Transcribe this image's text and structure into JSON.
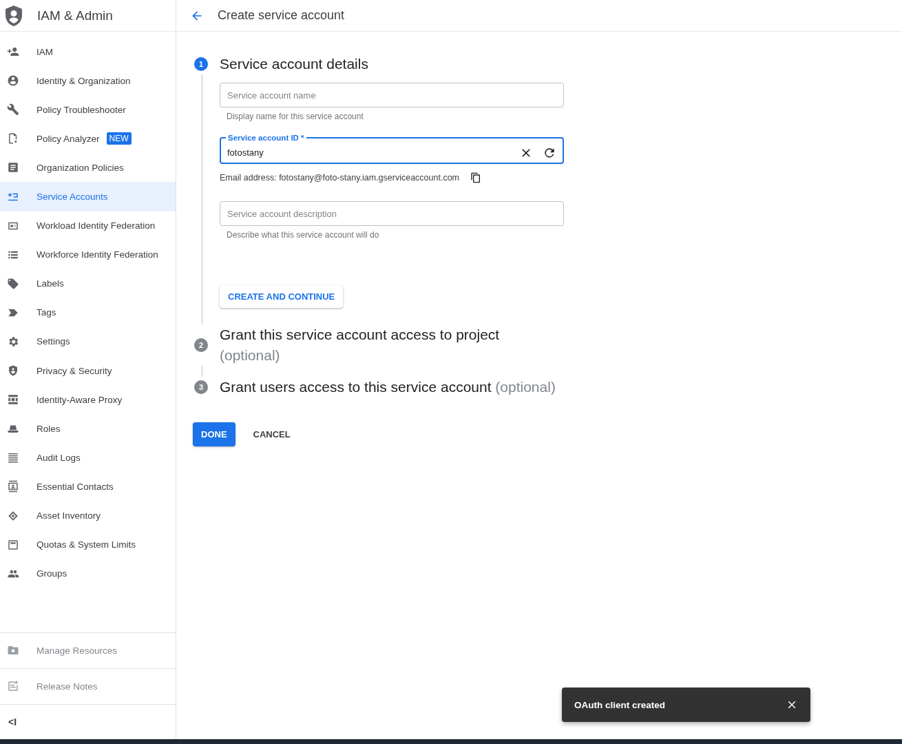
{
  "sidebar": {
    "title": "IAM & Admin",
    "items": [
      {
        "label": "IAM",
        "selected": false
      },
      {
        "label": "Identity & Organization",
        "selected": false
      },
      {
        "label": "Policy Troubleshooter",
        "selected": false
      },
      {
        "label": "Policy Analyzer",
        "selected": false,
        "badge": "NEW"
      },
      {
        "label": "Organization Policies",
        "selected": false
      },
      {
        "label": "Service Accounts",
        "selected": true
      },
      {
        "label": "Workload Identity Federation",
        "selected": false
      },
      {
        "label": "Workforce Identity Federation",
        "selected": false
      },
      {
        "label": "Labels",
        "selected": false
      },
      {
        "label": "Tags",
        "selected": false
      },
      {
        "label": "Settings",
        "selected": false
      },
      {
        "label": "Privacy & Security",
        "selected": false
      },
      {
        "label": "Identity-Aware Proxy",
        "selected": false
      },
      {
        "label": "Roles",
        "selected": false
      },
      {
        "label": "Audit Logs",
        "selected": false
      },
      {
        "label": "Essential Contacts",
        "selected": false
      },
      {
        "label": "Asset Inventory",
        "selected": false
      },
      {
        "label": "Quotas & System Limits",
        "selected": false
      },
      {
        "label": "Groups",
        "selected": false
      }
    ],
    "footer_items": [
      {
        "label": "Manage Resources",
        "disabled": true
      },
      {
        "label": "Release Notes",
        "disabled": true
      }
    ],
    "collapse": "<I"
  },
  "header": {
    "title": "Create service account"
  },
  "steps": [
    {
      "number": "1",
      "title": "Service account details",
      "active": true,
      "fields": [
        {
          "placeholder": "Service account name",
          "hint": "Display name for this service account",
          "focused": false
        },
        {
          "label": "Service account ID *",
          "value": "fotostany",
          "focused": true,
          "email": "Email address: fotostany@foto-stany.iam.gserviceaccount.com"
        },
        {
          "placeholder": "Service account description",
          "hint": "Describe what this service account will do",
          "focused": false
        }
      ],
      "button": "CREATE AND CONTINUE"
    },
    {
      "number": "2",
      "title": "Grant this service account access to project",
      "optional": "(optional)",
      "active": false
    },
    {
      "number": "3",
      "title": "Grant users access to this service account",
      "optional": "(optional)",
      "active": false
    }
  ],
  "buttons": [
    {
      "label": "DONE",
      "kind": "primary"
    },
    {
      "label": "CANCEL",
      "kind": "text"
    }
  ],
  "snackbar": {
    "message": "OAuth client created"
  }
}
